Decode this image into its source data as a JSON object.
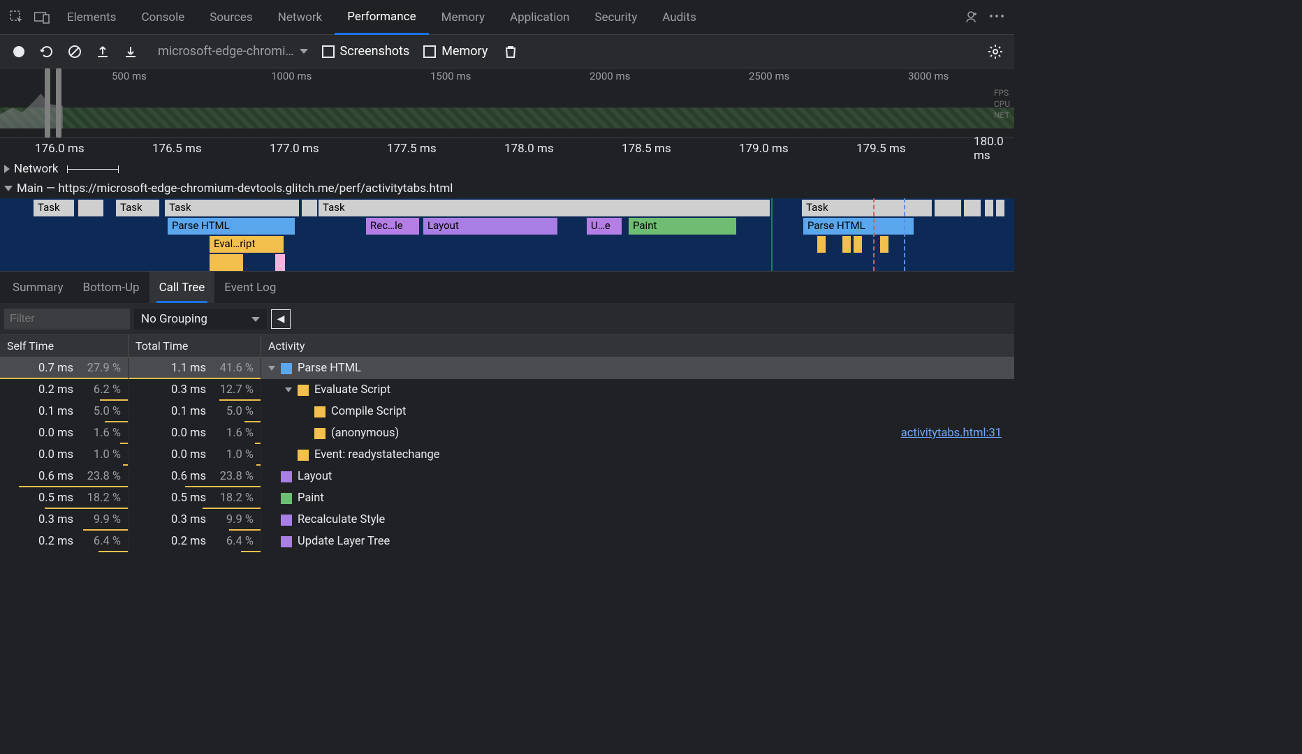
{
  "topTabs": {
    "items": [
      "Elements",
      "Console",
      "Sources",
      "Network",
      "Performance",
      "Memory",
      "Application",
      "Security",
      "Audits"
    ],
    "active": "Performance"
  },
  "toolbar": {
    "captureName": "microsoft-edge-chromi…",
    "screenshots_label": "Screenshots",
    "memory_label": "Memory"
  },
  "overviewRuler": [
    "500 ms",
    "1000 ms",
    "1500 ms",
    "2000 ms",
    "2500 ms",
    "3000 ms"
  ],
  "overviewLanes": [
    "FPS",
    "CPU",
    "NET"
  ],
  "flameRuler": [
    "176.0 ms",
    "176.5 ms",
    "177.0 ms",
    "177.5 ms",
    "178.0 ms",
    "178.5 ms",
    "179.0 ms",
    "179.5 ms",
    "180.0 ms"
  ],
  "network_label": "Network",
  "main_label": "Main — https://microsoft-edge-chromium-devtools.glitch.me/perf/activitytabs.html",
  "flameBars": {
    "task": "Task",
    "parse": "Parse HTML",
    "eval": "Eval…ript",
    "recalc": "Rec…le",
    "layout": "Layout",
    "update": "U…e",
    "paint": "Paint"
  },
  "bottomTabs": {
    "items": [
      "Summary",
      "Bottom-Up",
      "Call Tree",
      "Event Log"
    ],
    "active": "Call Tree"
  },
  "filter": {
    "placeholder": "Filter",
    "grouping": "No Grouping"
  },
  "table": {
    "cols": [
      "Self Time",
      "Total Time",
      "Activity"
    ],
    "rows": [
      {
        "self": "0.7 ms",
        "selfp": "27.9 %",
        "selfw": 100,
        "tot": "1.1 ms",
        "totp": "41.6 %",
        "totw": 100,
        "indent": 0,
        "expand": "open",
        "swatch": "#5aa7ee",
        "label": "Parse HTML",
        "sel": true,
        "link": ""
      },
      {
        "self": "0.2 ms",
        "selfp": "6.2 %",
        "selfw": 22,
        "tot": "0.3 ms",
        "totp": "12.7 %",
        "totw": 31,
        "indent": 1,
        "expand": "open",
        "swatch": "#f3c04e",
        "label": "Evaluate Script",
        "sel": false,
        "link": ""
      },
      {
        "self": "0.1 ms",
        "selfp": "5.0 %",
        "selfw": 18,
        "tot": "0.1 ms",
        "totp": "5.0 %",
        "totw": 12,
        "indent": 2,
        "expand": "none",
        "swatch": "#f3c04e",
        "label": "Compile Script",
        "sel": false,
        "link": ""
      },
      {
        "self": "0.0 ms",
        "selfp": "1.6 %",
        "selfw": 6,
        "tot": "0.0 ms",
        "totp": "1.6 %",
        "totw": 4,
        "indent": 2,
        "expand": "none",
        "swatch": "#f3c04e",
        "label": "(anonymous)",
        "sel": false,
        "link": "activitytabs.html:31"
      },
      {
        "self": "0.0 ms",
        "selfp": "1.0 %",
        "selfw": 4,
        "tot": "0.0 ms",
        "totp": "1.0 %",
        "totw": 3,
        "indent": 1,
        "expand": "none",
        "swatch": "#f3c04e",
        "label": "Event: readystatechange",
        "sel": false,
        "link": ""
      },
      {
        "self": "0.6 ms",
        "selfp": "23.8 %",
        "selfw": 85,
        "tot": "0.6 ms",
        "totp": "23.8 %",
        "totw": 57,
        "indent": 0,
        "expand": "none",
        "swatch": "#a97ee5",
        "label": "Layout",
        "sel": false,
        "link": ""
      },
      {
        "self": "0.5 ms",
        "selfp": "18.2 %",
        "selfw": 65,
        "tot": "0.5 ms",
        "totp": "18.2 %",
        "totw": 44,
        "indent": 0,
        "expand": "none",
        "swatch": "#6fbd72",
        "label": "Paint",
        "sel": false,
        "link": ""
      },
      {
        "self": "0.3 ms",
        "selfp": "9.9 %",
        "selfw": 35,
        "tot": "0.3 ms",
        "totp": "9.9 %",
        "totw": 24,
        "indent": 0,
        "expand": "none",
        "swatch": "#a97ee5",
        "label": "Recalculate Style",
        "sel": false,
        "link": ""
      },
      {
        "self": "0.2 ms",
        "selfp": "6.4 %",
        "selfw": 23,
        "tot": "0.2 ms",
        "totp": "6.4 %",
        "totw": 15,
        "indent": 0,
        "expand": "none",
        "swatch": "#a97ee5",
        "label": "Update Layer Tree",
        "sel": false,
        "link": ""
      }
    ]
  }
}
